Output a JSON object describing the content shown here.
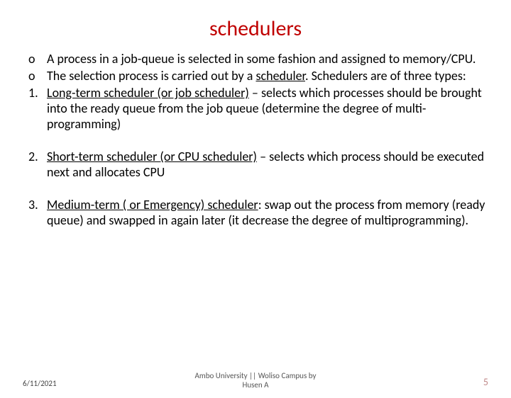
{
  "title": "schedulers",
  "bullets": {
    "o1": "A process in a job-queue is selected in some fashion  and assigned to memory/CPU.",
    "o2_a": "The selection process is carried out by a ",
    "o2_b": "scheduler",
    "o2_c": ". Schedulers are of three types:",
    "n1_a": "Long-term scheduler  (or job scheduler)",
    "n1_b": " – selects which processes should be brought into the ready queue from the job queue (determine the degree of multi-programming)",
    "n2_a": "Short-term scheduler  (or CPU scheduler)",
    "n2_b": " – selects which process should be executed next and allocates CPU",
    "n3_a": "Medium-term ( or Emergency) scheduler",
    "n3_b": ": swap out the process from memory (ready queue) and swapped in again later (it decrease the degree of multiprogramming)."
  },
  "markers": {
    "o": "o",
    "n1": "1.",
    "n2": "2.",
    "n3": "3."
  },
  "footer": {
    "date": "6/11/2021",
    "center1": "Ambo University || Woliso Campus      by",
    "center2": "Husen A",
    "page": "5"
  }
}
